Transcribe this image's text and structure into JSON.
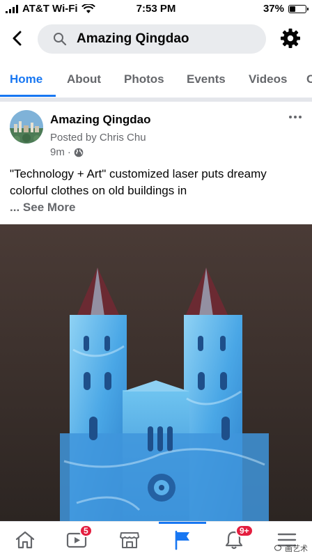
{
  "status_bar": {
    "carrier": "AT&T Wi-Fi",
    "time": "7:53 PM",
    "battery_percent": "37%",
    "battery_level": 0.37
  },
  "header": {
    "back_icon": "chevron-left-icon",
    "search_icon": "search-icon",
    "search_text": "Amazing Qingdao",
    "settings_icon": "gear-icon"
  },
  "tabs": [
    {
      "label": "Home",
      "active": true
    },
    {
      "label": "About",
      "active": false
    },
    {
      "label": "Photos",
      "active": false
    },
    {
      "label": "Events",
      "active": false
    },
    {
      "label": "Videos",
      "active": false
    },
    {
      "label": "C",
      "active": false
    }
  ],
  "post": {
    "page_name": "Amazing Qingdao",
    "posted_by": "Posted by Chris Chu",
    "time": "9m",
    "audience_icon": "globe-icon",
    "text": "\"Technology + Art\" customized laser puts dreamy colorful clothes on old buildings in",
    "ellipsis": "...",
    "see_more": "See More"
  },
  "bottom_nav": {
    "items": [
      {
        "icon": "home-icon",
        "badge": ""
      },
      {
        "icon": "video-icon",
        "badge": "5"
      },
      {
        "icon": "marketplace-icon",
        "badge": ""
      },
      {
        "icon": "page-flag-icon",
        "badge": "",
        "active": true
      },
      {
        "icon": "bell-icon",
        "badge": "9+"
      },
      {
        "icon": "menu-icon",
        "badge": ""
      }
    ]
  },
  "watermark": "画艺术",
  "colors": {
    "accent": "#1877f2",
    "badge": "#e41e3f",
    "secondary_text": "#65676b"
  }
}
